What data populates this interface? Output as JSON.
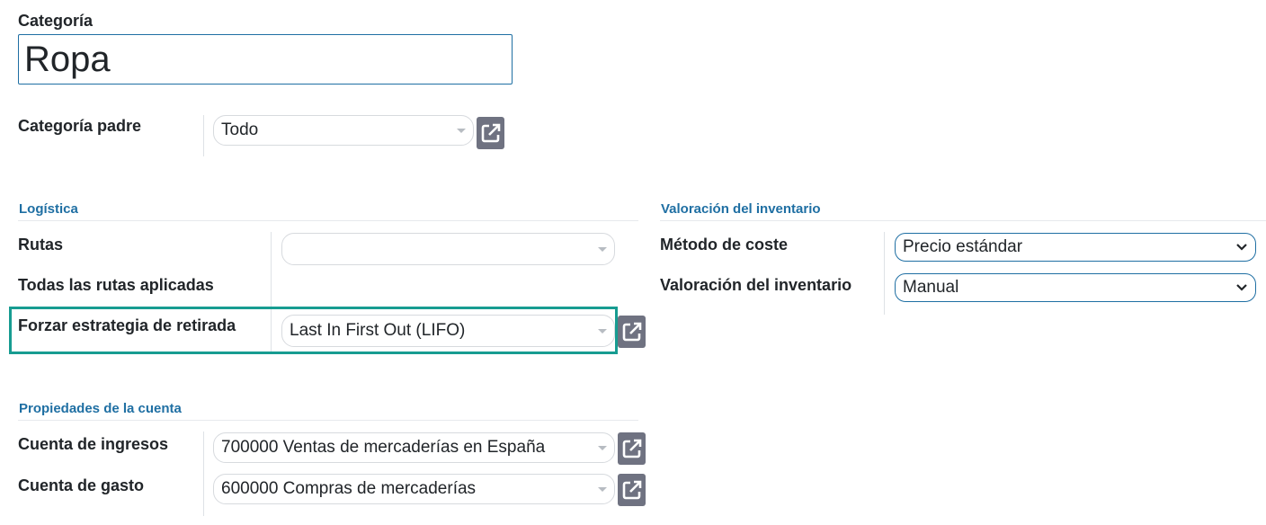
{
  "category": {
    "label": "Categoría",
    "name_value": "Ropa",
    "parent_label": "Categoría padre",
    "parent_value": "Todo"
  },
  "logistics": {
    "title": "Logística",
    "routes_label": "Rutas",
    "routes_value": "",
    "all_routes_label": "Todas las rutas aplicadas",
    "removal_label": "Forzar estrategia de retirada",
    "removal_value": "Last In First Out (LIFO)"
  },
  "valuation": {
    "title": "Valoración del inventario",
    "cost_method_label": "Método de coste",
    "cost_method_value": "Precio estándar",
    "valuation_label": "Valoración del inventario",
    "valuation_value": "Manual"
  },
  "accounts": {
    "title": "Propiedades de la cuenta",
    "income_label": "Cuenta de ingresos",
    "income_value": "700000 Ventas de mercaderías en España",
    "expense_label": "Cuenta de gasto",
    "expense_value": "600000 Compras de mercaderías"
  },
  "icons": {
    "external_link": "external-link-icon",
    "dropdown": "chevron-down-icon",
    "caret": "caret-down-icon"
  },
  "colors": {
    "section_title": "#1f6fa3",
    "input_border_active": "#1f6fa3",
    "highlight_border": "#179c91",
    "external_button": "#6f7281"
  }
}
